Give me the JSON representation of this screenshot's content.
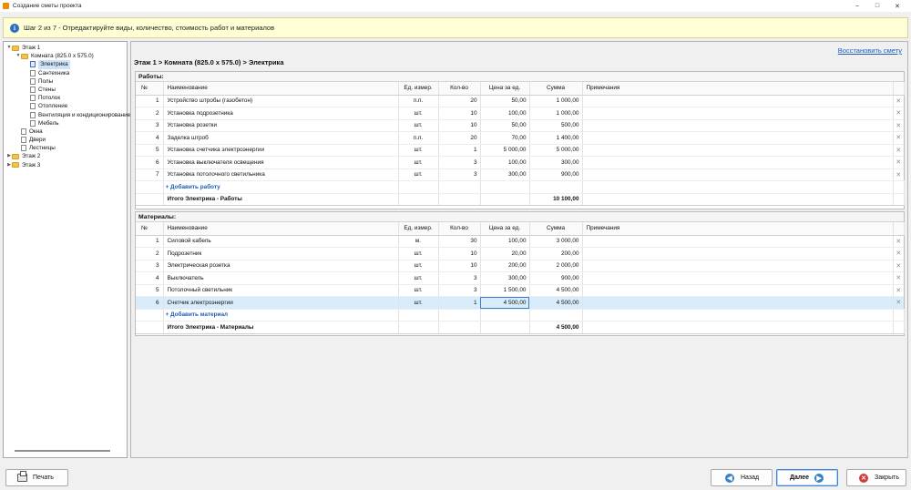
{
  "window": {
    "title": "Создание сметы проекта",
    "controls": [
      "–",
      "□",
      "✕"
    ]
  },
  "info": {
    "text": "Шаг 2 из 7 - Отредактируйте виды, количество, стоимость работ и материалов"
  },
  "tree": [
    {
      "label": "Этаж 1",
      "level": 0,
      "expanded": true,
      "type": "folder"
    },
    {
      "label": "Комната (825.0 x 575.0)",
      "level": 1,
      "expanded": true,
      "type": "folder"
    },
    {
      "label": "Электрика",
      "level": 2,
      "type": "doc",
      "selected": true
    },
    {
      "label": "Сантехника",
      "level": 2,
      "type": "doc"
    },
    {
      "label": "Полы",
      "level": 2,
      "type": "doc"
    },
    {
      "label": "Стены",
      "level": 2,
      "type": "doc"
    },
    {
      "label": "Потолок",
      "level": 2,
      "type": "doc"
    },
    {
      "label": "Отопление",
      "level": 2,
      "type": "doc"
    },
    {
      "label": "Вентиляция и кондиционирование",
      "level": 2,
      "type": "doc"
    },
    {
      "label": "Мебель",
      "level": 2,
      "type": "doc"
    },
    {
      "label": "Окна",
      "level": 1,
      "type": "doc"
    },
    {
      "label": "Двери",
      "level": 1,
      "type": "doc"
    },
    {
      "label": "Лестницы",
      "level": 1,
      "type": "doc"
    },
    {
      "label": "Этаж 2",
      "level": 0,
      "expanded": false,
      "type": "folder"
    },
    {
      "label": "Этаж 3",
      "level": 0,
      "expanded": false,
      "type": "folder"
    }
  ],
  "main": {
    "restore_link": "Восстановить смету",
    "breadcrumb": "Этаж 1 > Комната (825.0 x 575.0) > Электрика"
  },
  "columns": {
    "num": "№",
    "name": "Наименование",
    "unit": "Ед. измер.",
    "qty": "Кол-во",
    "price": "Цена за ед.",
    "sum": "Сумма",
    "notes": "Примечания"
  },
  "works": {
    "title": "Работы:",
    "rows": [
      {
        "num": "1",
        "name": "Устройство штробы (газобетон)",
        "unit": "п.п.",
        "qty": "20",
        "price": "50,00",
        "sum": "1 000,00",
        "notes": ""
      },
      {
        "num": "2",
        "name": "Установка подрозетника",
        "unit": "шт.",
        "qty": "10",
        "price": "100,00",
        "sum": "1 000,00",
        "notes": ""
      },
      {
        "num": "3",
        "name": "Установка розетки",
        "unit": "шт.",
        "qty": "10",
        "price": "50,00",
        "sum": "500,00",
        "notes": ""
      },
      {
        "num": "4",
        "name": "Заделка штроб",
        "unit": "п.п.",
        "qty": "20",
        "price": "70,00",
        "sum": "1 400,00",
        "notes": ""
      },
      {
        "num": "5",
        "name": "Установка счетчика электроэнергии",
        "unit": "шт.",
        "qty": "1",
        "price": "5 000,00",
        "sum": "5 000,00",
        "notes": ""
      },
      {
        "num": "6",
        "name": "Установка выключателя освещения",
        "unit": "шт.",
        "qty": "3",
        "price": "100,00",
        "sum": "300,00",
        "notes": ""
      },
      {
        "num": "7",
        "name": "Установка потолочного светильника",
        "unit": "шт.",
        "qty": "3",
        "price": "300,00",
        "sum": "900,00",
        "notes": ""
      }
    ],
    "add_label": "+ Добавить работу",
    "total_label": "Итого Электрика - Работы",
    "total_value": "10 100,00"
  },
  "materials": {
    "title": "Материалы:",
    "rows": [
      {
        "num": "1",
        "name": "Силовой кабель",
        "unit": "м.",
        "qty": "30",
        "price": "100,00",
        "sum": "3 000,00",
        "notes": ""
      },
      {
        "num": "2",
        "name": "Подрозетник",
        "unit": "шт.",
        "qty": "10",
        "price": "20,00",
        "sum": "200,00",
        "notes": ""
      },
      {
        "num": "3",
        "name": "Электрическая розетка",
        "unit": "шт.",
        "qty": "10",
        "price": "200,00",
        "sum": "2 000,00",
        "notes": ""
      },
      {
        "num": "4",
        "name": "Выключатель",
        "unit": "шт.",
        "qty": "3",
        "price": "300,00",
        "sum": "900,00",
        "notes": ""
      },
      {
        "num": "5",
        "name": "Потолочный светильник",
        "unit": "шт.",
        "qty": "3",
        "price": "1 500,00",
        "sum": "4 500,00",
        "notes": ""
      },
      {
        "num": "6",
        "name": "Счетчик электроэнергии",
        "unit": "шт.",
        "qty": "1",
        "price": "4 500,00",
        "sum": "4 500,00",
        "notes": "",
        "selected": true
      }
    ],
    "add_label": "+ Добавить материал",
    "total_label": "Итого Электрика - Материалы",
    "total_value": "4 500,00"
  },
  "delete_glyph": "✕",
  "footer": {
    "print": "Печать",
    "back": "Назад",
    "next": "Далее",
    "close": "Закрыть"
  },
  "colors": {
    "accent": "#1c5db8",
    "info_bg": "#fffed5",
    "selected_row": "#d9ecfb",
    "folder": "#f3c24d"
  }
}
